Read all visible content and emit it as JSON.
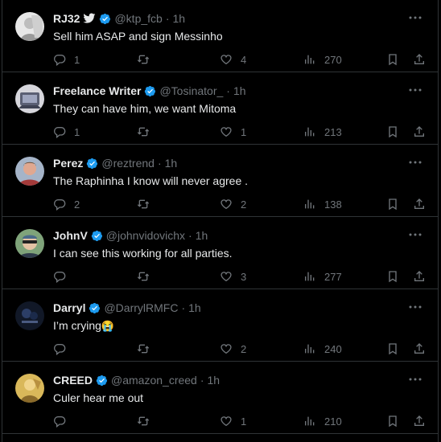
{
  "tweets": [
    {
      "name": "RJ32",
      "handle": "@ktp_fcb",
      "time": "1h",
      "text": "Sell him ASAP and sign Messinho",
      "replies": "1",
      "retweets": "",
      "likes": "4",
      "views": "270",
      "avatar_color": "#d9d9d9"
    },
    {
      "name": "Freelance Writer",
      "handle": "@Tosinator_",
      "time": "1h",
      "text": "They can have him, we want Mitoma",
      "replies": "1",
      "retweets": "",
      "likes": "1",
      "views": "213",
      "avatar_color": "#8a8fa0"
    },
    {
      "name": "Perez",
      "handle": "@reztrend",
      "time": "1h",
      "text": "The Raphinha I know will never agree .",
      "replies": "2",
      "retweets": "",
      "likes": "2",
      "views": "138",
      "avatar_color": "#b97a6a"
    },
    {
      "name": "JohnV",
      "handle": "@johnvidovichx",
      "time": "1h",
      "text": "I can see this working for all parties.",
      "replies": "",
      "retweets": "",
      "likes": "3",
      "views": "277",
      "avatar_color": "#6f8f6a"
    },
    {
      "name": "Darryl",
      "handle": "@DarrylRMFC",
      "time": "1h",
      "text": "I’m crying",
      "emoji": "😭",
      "replies": "",
      "retweets": "",
      "likes": "2",
      "views": "240",
      "avatar_color": "#1c2233"
    },
    {
      "name": "CREED",
      "handle": "@amazon_creed",
      "time": "1h",
      "text": "Culer hear me out",
      "replies": "",
      "retweets": "",
      "likes": "1",
      "views": "210",
      "avatar_color": "#c9a64a"
    }
  ],
  "icons": {
    "verified": "verified-badge-icon",
    "bird": "twitter-bird-icon",
    "more": "more-options-icon",
    "reply": "reply-icon",
    "retweet": "retweet-icon",
    "like": "heart-icon",
    "views": "views-icon",
    "bookmark": "bookmark-icon",
    "share": "share-icon"
  },
  "colors": {
    "background": "#000000",
    "text": "#e7e9ea",
    "secondary": "#71767b",
    "border": "#2f3336",
    "verified": "#1d9bf0"
  }
}
